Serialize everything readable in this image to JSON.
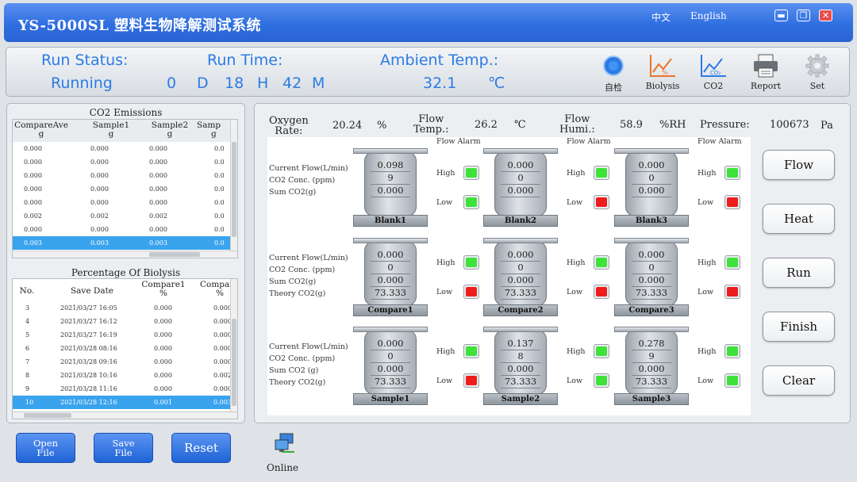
{
  "app": {
    "title": "YS-5000SL 塑料生物降解测试系统",
    "lang_cn": "中文",
    "lang_en": "English"
  },
  "window_controls": {
    "minimize": "minimize-icon",
    "restore": "restore-icon",
    "close": "close-icon"
  },
  "status": {
    "run_status_label": "Run Status:",
    "run_status_value": "Running",
    "run_time_label": "Run Time:",
    "days": "0",
    "d": "D",
    "hours": "18",
    "h": "H",
    "minutes": "42",
    "m": "M",
    "ambient_label": "Ambient Temp.:",
    "ambient_value": "32.1",
    "ambient_unit": "℃"
  },
  "toolbar": [
    {
      "label": "自检",
      "icon": "self-check-icon"
    },
    {
      "label": "Biolysis",
      "icon": "biolysis-chart-icon"
    },
    {
      "label": "CO2",
      "icon": "co2-chart-icon"
    },
    {
      "label": "Report",
      "icon": "printer-icon"
    },
    {
      "label": "Set",
      "icon": "gear-icon"
    }
  ],
  "co2_table": {
    "title": "CO2 Emissions",
    "headers": [
      [
        "CompareAve",
        "g"
      ],
      [
        "Sample1",
        "g"
      ],
      [
        "Sample2",
        "g"
      ],
      [
        "Samp",
        "g"
      ]
    ],
    "rows": [
      [
        "0.000",
        "0.000",
        "0.000",
        "0.0"
      ],
      [
        "0.000",
        "0.000",
        "0.000",
        "0.0"
      ],
      [
        "0.000",
        "0.000",
        "0.000",
        "0.0"
      ],
      [
        "0.000",
        "0.000",
        "0.000",
        "0.0"
      ],
      [
        "0.000",
        "0.000",
        "0.000",
        "0.0"
      ],
      [
        "0.002",
        "0.002",
        "0.002",
        "0.0"
      ],
      [
        "0.000",
        "0.000",
        "0.000",
        "0.0"
      ],
      [
        "0.003",
        "0.003",
        "0.003",
        "0.0"
      ]
    ]
  },
  "biolysis_table": {
    "title": "Percentage Of Biolysis",
    "headers": [
      [
        "No.",
        ""
      ],
      [
        "Save Date",
        ""
      ],
      [
        "Compare1",
        "%"
      ],
      [
        "Compar",
        "%"
      ]
    ],
    "rows": [
      [
        "3",
        "2021/03/27 16:05",
        "0.000",
        "0.000"
      ],
      [
        "4",
        "2021/03/27 16:12",
        "0.000",
        "0.000"
      ],
      [
        "5",
        "2021/03/27 16:19",
        "0.000",
        "0.000"
      ],
      [
        "6",
        "2021/03/28 08:16",
        "0.000",
        "0.000"
      ],
      [
        "7",
        "2021/03/28 09:16",
        "0.000",
        "0.000"
      ],
      [
        "8",
        "2021/03/28 10:16",
        "0.000",
        "0.002"
      ],
      [
        "9",
        "2021/03/28 11:16",
        "0.000",
        "0.000"
      ],
      [
        "10",
        "2021/03/28 12:16",
        "0.001",
        "0.003"
      ]
    ]
  },
  "info_bar": {
    "oxygen_label_1": "Oxygen",
    "oxygen_label_2": "Rate:",
    "oxygen_value": "20.24",
    "oxygen_unit": "%",
    "flow_temp_label_1": "Flow",
    "flow_temp_label_2": "Temp.:",
    "flow_temp_value": "26.2",
    "flow_temp_unit": "℃",
    "flow_humi_label_1": "Flow",
    "flow_humi_label_2": "Humi.:",
    "flow_humi_value": "58.9",
    "flow_humi_unit": "%RH",
    "pressure_label": "Pressure:",
    "pressure_value": "100673",
    "pressure_unit": "Pa"
  },
  "monitor": {
    "flow_alarm": "Flow Alarm",
    "high": "High",
    "low": "Low",
    "labels": [
      "Current Flow(L/min)",
      "CO2 Conc. (ppm)",
      "Sum CO2(g)",
      "Theory CO2(g)"
    ],
    "labels_row3": [
      "Current Flow(L/min)",
      "CO2 Conc. (ppm)",
      "Sum CO2 (g)",
      "Theory CO2(g)"
    ],
    "led_colors": {
      "green": "#3ee23a",
      "red": "#ee1c1c"
    },
    "rows": [
      {
        "tanks": [
          {
            "name": "Blank1",
            "values": [
              "0.098",
              "9",
              "0.000"
            ],
            "high": "green",
            "low": "green"
          },
          {
            "name": "Blank2",
            "values": [
              "0.000",
              "0",
              "0.000"
            ],
            "high": "green",
            "low": "red"
          },
          {
            "name": "Blank3",
            "values": [
              "0.000",
              "0",
              "0.000"
            ],
            "high": "green",
            "low": "red"
          }
        ]
      },
      {
        "tanks": [
          {
            "name": "Compare1",
            "values": [
              "0.000",
              "0",
              "0.000",
              "73.333"
            ],
            "high": "green",
            "low": "red"
          },
          {
            "name": "Compare2",
            "values": [
              "0.000",
              "0",
              "0.000",
              "73.333"
            ],
            "high": "green",
            "low": "red"
          },
          {
            "name": "Compare3",
            "values": [
              "0.000",
              "0",
              "0.000",
              "73.333"
            ],
            "high": "green",
            "low": "red"
          }
        ]
      },
      {
        "tanks": [
          {
            "name": "Sample1",
            "values": [
              "0.000",
              "0",
              "0.000",
              "73.333"
            ],
            "high": "green",
            "low": "red"
          },
          {
            "name": "Sample2",
            "values": [
              "0.137",
              "8",
              "0.000",
              "73.333"
            ],
            "high": "green",
            "low": "green"
          },
          {
            "name": "Sample3",
            "values": [
              "0.278",
              "9",
              "0.000",
              "73.333"
            ],
            "high": "green",
            "low": "green"
          }
        ]
      }
    ]
  },
  "side_buttons": [
    "Flow",
    "Heat",
    "Run",
    "Finish",
    "Clear"
  ],
  "bottom_buttons": {
    "open_1": "Open",
    "open_2": "File",
    "save_1": "Save",
    "save_2": "File",
    "reset": "Reset"
  },
  "online": {
    "label": "Online",
    "icon": "network-computer-icon"
  },
  "colors": {
    "title_blue": "#2f6fe0",
    "status_text": "#2c7be5",
    "selection": "#3aa3ee"
  }
}
